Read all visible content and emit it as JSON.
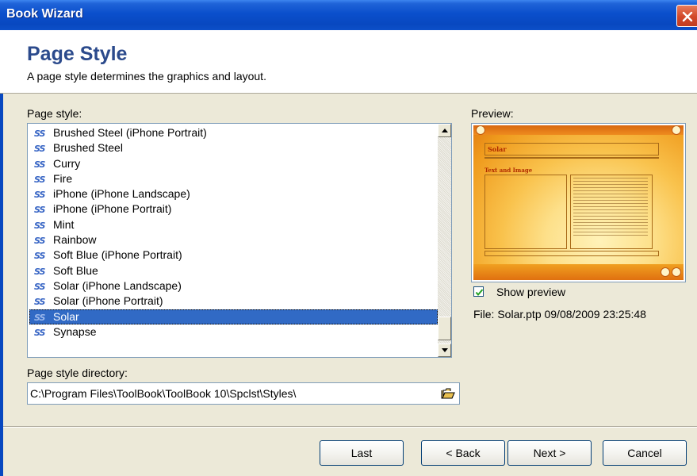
{
  "window": {
    "title": "Book Wizard"
  },
  "header": {
    "heading": "Page Style",
    "subheading": "A page style determines the graphics and layout."
  },
  "page_style": {
    "label": "Page style:",
    "icon": "SS",
    "items": [
      {
        "label": "Brushed Steel (iPhone Portrait)",
        "selected": false
      },
      {
        "label": "Brushed Steel",
        "selected": false
      },
      {
        "label": "Curry",
        "selected": false
      },
      {
        "label": "Fire",
        "selected": false
      },
      {
        "label": "iPhone (iPhone Landscape)",
        "selected": false
      },
      {
        "label": "iPhone (iPhone Portrait)",
        "selected": false
      },
      {
        "label": "Mint",
        "selected": false
      },
      {
        "label": "Rainbow",
        "selected": false
      },
      {
        "label": "Soft Blue (iPhone Portrait)",
        "selected": false
      },
      {
        "label": "Soft Blue",
        "selected": false
      },
      {
        "label": "Solar (iPhone Landscape)",
        "selected": false
      },
      {
        "label": "Solar (iPhone Portrait)",
        "selected": false
      },
      {
        "label": "Solar",
        "selected": true
      },
      {
        "label": "Synapse",
        "selected": false
      }
    ]
  },
  "directory": {
    "label": "Page style directory:",
    "value": "C:\\Program Files\\ToolBook\\ToolBook 10\\Spclst\\Styles\\"
  },
  "preview": {
    "label": "Preview:",
    "thumb_title": "Solar",
    "thumb_subtitle": "Text and Image",
    "show_preview_label": "Show preview",
    "show_preview_checked": true,
    "file_info": "File: Solar.ptp 09/08/2009 23:25:48"
  },
  "buttons": {
    "last": "Last",
    "back": "< Back",
    "next": "Next >",
    "cancel": "Cancel"
  },
  "colors": {
    "titlebar": "#0848c0",
    "heading": "#2b4a8c",
    "selection": "#316ac5"
  }
}
